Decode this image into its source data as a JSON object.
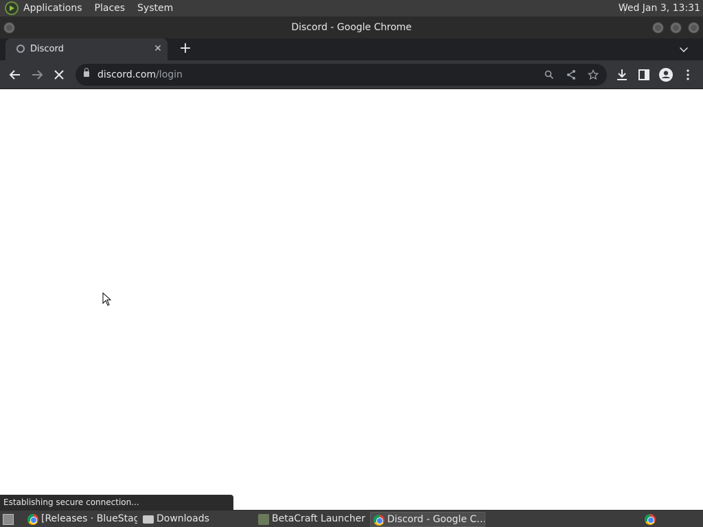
{
  "top_panel": {
    "menus": [
      "Applications",
      "Places",
      "System"
    ],
    "clock": "Wed Jan  3, 13:31"
  },
  "window": {
    "title": "Discord - Google Chrome"
  },
  "tabs": [
    {
      "label": "Discord",
      "icon": "loading-icon",
      "active": true
    }
  ],
  "toolbar": {
    "url_host": "discord.com",
    "url_path": "/login",
    "icons": [
      "back-icon",
      "forward-icon",
      "stop-icon",
      "zoom-icon",
      "share-icon",
      "bookmark-star-icon",
      "download-icon",
      "side-panel-icon",
      "profile-icon",
      "menu-icon"
    ]
  },
  "status_text": "Establishing secure connection...",
  "taskbar": {
    "items": [
      {
        "label": "[Releases · BlueStag…",
        "icon": "chrome-icon",
        "active": false
      },
      {
        "label": "Downloads",
        "icon": "folder-icon",
        "active": false
      },
      {
        "label": "BetaCraft Launcher …",
        "icon": "betacraft-icon",
        "active": false
      },
      {
        "label": "Discord - Google C…",
        "icon": "chrome-icon",
        "active": true
      }
    ]
  }
}
